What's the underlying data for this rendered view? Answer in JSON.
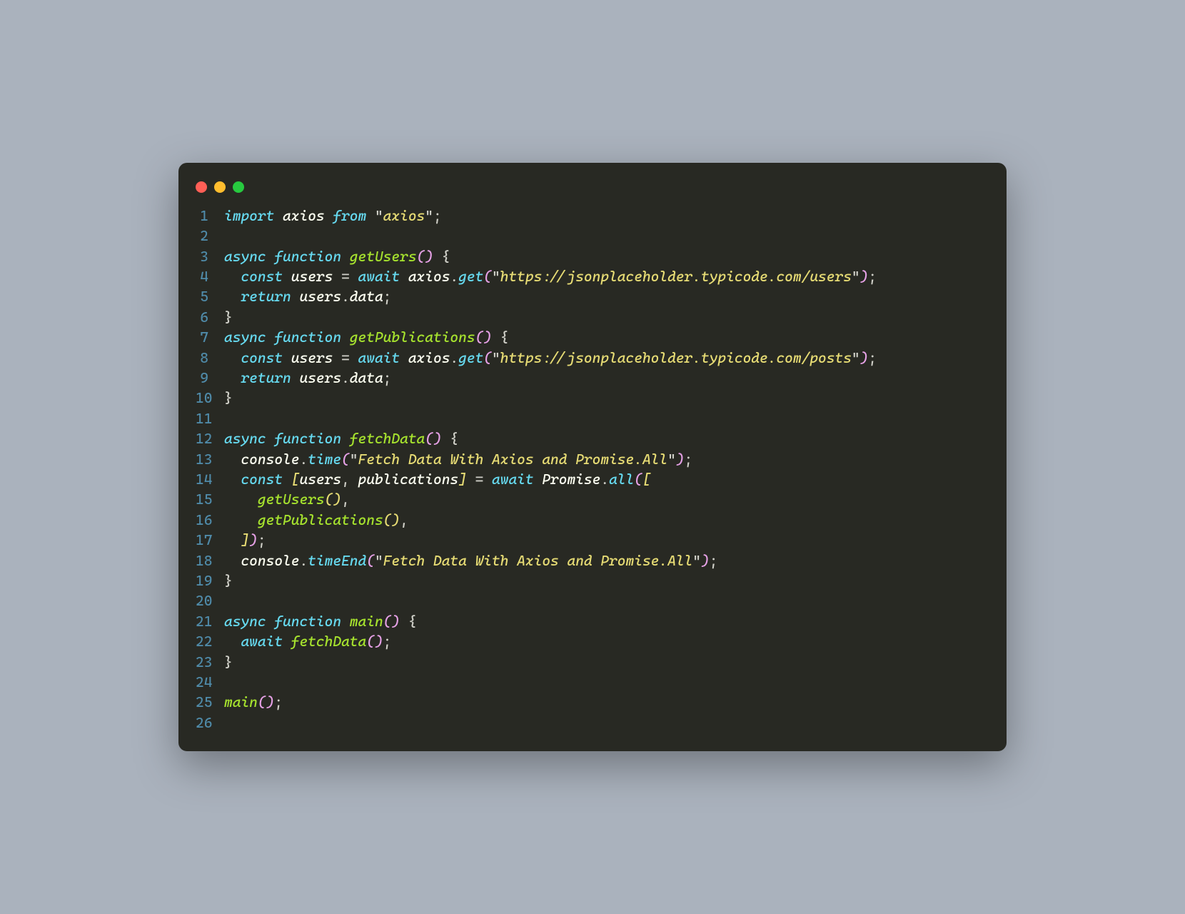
{
  "window": {
    "traffic_lights": [
      "close",
      "minimize",
      "zoom"
    ]
  },
  "code": {
    "language": "javascript",
    "line_numbers": [
      1,
      2,
      3,
      4,
      5,
      6,
      7,
      8,
      9,
      10,
      11,
      12,
      13,
      14,
      15,
      16,
      17,
      18,
      19,
      20,
      21,
      22,
      23,
      24,
      25,
      26
    ],
    "lines": [
      [
        {
          "t": "import ",
          "c": "kw"
        },
        {
          "t": "axios ",
          "c": "def"
        },
        {
          "t": "from ",
          "c": "kw"
        },
        {
          "t": "\"",
          "c": "punc"
        },
        {
          "t": "axios",
          "c": "str"
        },
        {
          "t": "\"",
          "c": "punc"
        },
        {
          "t": ";",
          "c": "punc"
        }
      ],
      [],
      [
        {
          "t": "async ",
          "c": "kw"
        },
        {
          "t": "function ",
          "c": "kw"
        },
        {
          "t": "getUsers",
          "c": "fn"
        },
        {
          "t": "()",
          "c": "paren"
        },
        {
          "t": " ",
          "c": "def"
        },
        {
          "t": "{",
          "c": "brace"
        }
      ],
      [
        {
          "t": "  ",
          "c": "def"
        },
        {
          "t": "const ",
          "c": "kw"
        },
        {
          "t": "users ",
          "c": "def"
        },
        {
          "t": "= ",
          "c": "punc"
        },
        {
          "t": "await ",
          "c": "kw"
        },
        {
          "t": "axios",
          "c": "obj"
        },
        {
          "t": ".",
          "c": "punc"
        },
        {
          "t": "get",
          "c": "call"
        },
        {
          "t": "(",
          "c": "paren"
        },
        {
          "t": "\"",
          "c": "punc"
        },
        {
          "t": "https://jsonplaceholder.typicode.com/users",
          "c": "str"
        },
        {
          "t": "\"",
          "c": "punc"
        },
        {
          "t": ")",
          "c": "paren"
        },
        {
          "t": ";",
          "c": "punc"
        }
      ],
      [
        {
          "t": "  ",
          "c": "def"
        },
        {
          "t": "return ",
          "c": "kw"
        },
        {
          "t": "users",
          "c": "obj"
        },
        {
          "t": ".",
          "c": "punc"
        },
        {
          "t": "data",
          "c": "prop"
        },
        {
          "t": ";",
          "c": "punc"
        }
      ],
      [
        {
          "t": "}",
          "c": "brace"
        }
      ],
      [
        {
          "t": "async ",
          "c": "kw"
        },
        {
          "t": "function ",
          "c": "kw"
        },
        {
          "t": "getPublications",
          "c": "fn"
        },
        {
          "t": "()",
          "c": "paren"
        },
        {
          "t": " ",
          "c": "def"
        },
        {
          "t": "{",
          "c": "brace"
        }
      ],
      [
        {
          "t": "  ",
          "c": "def"
        },
        {
          "t": "const ",
          "c": "kw"
        },
        {
          "t": "users ",
          "c": "def"
        },
        {
          "t": "= ",
          "c": "punc"
        },
        {
          "t": "await ",
          "c": "kw"
        },
        {
          "t": "axios",
          "c": "obj"
        },
        {
          "t": ".",
          "c": "punc"
        },
        {
          "t": "get",
          "c": "call"
        },
        {
          "t": "(",
          "c": "paren"
        },
        {
          "t": "\"",
          "c": "punc"
        },
        {
          "t": "https://jsonplaceholder.typicode.com/posts",
          "c": "str"
        },
        {
          "t": "\"",
          "c": "punc"
        },
        {
          "t": ")",
          "c": "paren"
        },
        {
          "t": ";",
          "c": "punc"
        }
      ],
      [
        {
          "t": "  ",
          "c": "def"
        },
        {
          "t": "return ",
          "c": "kw"
        },
        {
          "t": "users",
          "c": "obj"
        },
        {
          "t": ".",
          "c": "punc"
        },
        {
          "t": "data",
          "c": "prop"
        },
        {
          "t": ";",
          "c": "punc"
        }
      ],
      [
        {
          "t": "}",
          "c": "brace"
        }
      ],
      [],
      [
        {
          "t": "async ",
          "c": "kw"
        },
        {
          "t": "function ",
          "c": "kw"
        },
        {
          "t": "fetchData",
          "c": "fn"
        },
        {
          "t": "()",
          "c": "paren"
        },
        {
          "t": " ",
          "c": "def"
        },
        {
          "t": "{",
          "c": "brace"
        }
      ],
      [
        {
          "t": "  ",
          "c": "def"
        },
        {
          "t": "console",
          "c": "obj"
        },
        {
          "t": ".",
          "c": "punc"
        },
        {
          "t": "time",
          "c": "call"
        },
        {
          "t": "(",
          "c": "paren"
        },
        {
          "t": "\"",
          "c": "punc"
        },
        {
          "t": "Fetch Data With Axios and Promise.All",
          "c": "str"
        },
        {
          "t": "\"",
          "c": "punc"
        },
        {
          "t": ")",
          "c": "paren"
        },
        {
          "t": ";",
          "c": "punc"
        }
      ],
      [
        {
          "t": "  ",
          "c": "def"
        },
        {
          "t": "const ",
          "c": "kw"
        },
        {
          "t": "[",
          "c": "brak"
        },
        {
          "t": "users",
          "c": "def"
        },
        {
          "t": ", ",
          "c": "punc"
        },
        {
          "t": "publications",
          "c": "def"
        },
        {
          "t": "]",
          "c": "brak"
        },
        {
          "t": " = ",
          "c": "punc"
        },
        {
          "t": "await ",
          "c": "kw"
        },
        {
          "t": "Promise",
          "c": "obj"
        },
        {
          "t": ".",
          "c": "punc"
        },
        {
          "t": "all",
          "c": "call"
        },
        {
          "t": "(",
          "c": "paren"
        },
        {
          "t": "[",
          "c": "brak"
        }
      ],
      [
        {
          "t": "    ",
          "c": "def"
        },
        {
          "t": "getUsers",
          "c": "fn"
        },
        {
          "t": "()",
          "c": "brak"
        },
        {
          "t": ",",
          "c": "punc"
        }
      ],
      [
        {
          "t": "    ",
          "c": "def"
        },
        {
          "t": "getPublications",
          "c": "fn"
        },
        {
          "t": "()",
          "c": "brak"
        },
        {
          "t": ",",
          "c": "punc"
        }
      ],
      [
        {
          "t": "  ",
          "c": "def"
        },
        {
          "t": "]",
          "c": "brak"
        },
        {
          "t": ")",
          "c": "paren"
        },
        {
          "t": ";",
          "c": "punc"
        }
      ],
      [
        {
          "t": "  ",
          "c": "def"
        },
        {
          "t": "console",
          "c": "obj"
        },
        {
          "t": ".",
          "c": "punc"
        },
        {
          "t": "timeEnd",
          "c": "call"
        },
        {
          "t": "(",
          "c": "paren"
        },
        {
          "t": "\"",
          "c": "punc"
        },
        {
          "t": "Fetch Data With Axios and Promise.All",
          "c": "str"
        },
        {
          "t": "\"",
          "c": "punc"
        },
        {
          "t": ")",
          "c": "paren"
        },
        {
          "t": ";",
          "c": "punc"
        }
      ],
      [
        {
          "t": "}",
          "c": "brace"
        }
      ],
      [],
      [
        {
          "t": "async ",
          "c": "kw"
        },
        {
          "t": "function ",
          "c": "kw"
        },
        {
          "t": "main",
          "c": "fn"
        },
        {
          "t": "()",
          "c": "paren"
        },
        {
          "t": " ",
          "c": "def"
        },
        {
          "t": "{",
          "c": "brace"
        }
      ],
      [
        {
          "t": "  ",
          "c": "def"
        },
        {
          "t": "await ",
          "c": "kw"
        },
        {
          "t": "fetchData",
          "c": "fn"
        },
        {
          "t": "()",
          "c": "paren"
        },
        {
          "t": ";",
          "c": "punc"
        }
      ],
      [
        {
          "t": "}",
          "c": "brace"
        }
      ],
      [],
      [
        {
          "t": "main",
          "c": "fn"
        },
        {
          "t": "()",
          "c": "paren"
        },
        {
          "t": ";",
          "c": "punc"
        }
      ],
      []
    ]
  }
}
